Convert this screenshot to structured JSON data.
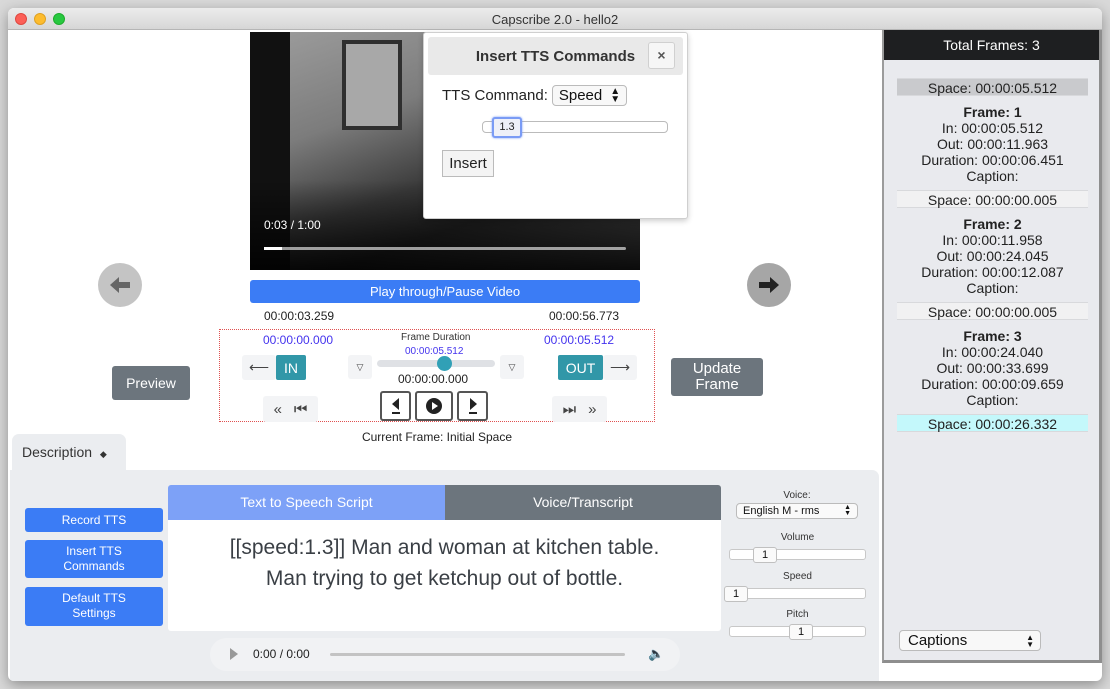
{
  "window": {
    "title": "Capscribe 2.0 - hello2"
  },
  "video": {
    "time_display": "0:03 / 1:00",
    "progress": 0.05
  },
  "modal": {
    "title": "Insert TTS Commands",
    "close_label": "×",
    "command_label": "TTS Command:",
    "command_value": "Speed",
    "slider_value": "1.3",
    "insert_label": "Insert"
  },
  "player": {
    "play_pause_label": "Play through/Pause Video",
    "start_time": "00:00:03.259",
    "end_time": "00:00:56.773"
  },
  "controls": {
    "in_time": "00:00:00.000",
    "out_time": "00:00:05.512",
    "frame_duration_label": "Frame Duration",
    "frame_duration_value": "00:00:05.512",
    "current_time": "00:00:00.000",
    "in_label": "IN",
    "out_label": "OUT",
    "current_frame_label": "Current Frame: Initial Space"
  },
  "buttons": {
    "preview": "Preview",
    "update_frame_line1": "Update",
    "update_frame_line2": "Frame"
  },
  "description": {
    "tab_label": "Description",
    "side_buttons": [
      {
        "line1": "Record TTS",
        "line2": ""
      },
      {
        "line1": "Insert TTS",
        "line2": "Commands"
      },
      {
        "line1": "Default TTS",
        "line2": "Settings"
      }
    ],
    "tabs": [
      {
        "label": "Text to Speech Script",
        "active": true
      },
      {
        "label": "Voice/Transcript",
        "active": false
      }
    ],
    "script_line1": "[[speed:1.3]] Man and woman at kitchen table.",
    "script_line2": "Man trying to get ketchup out of bottle.",
    "audio_time": "0:00 / 0:00"
  },
  "voice_settings": {
    "voice_label": "Voice:",
    "voice_value": "English M - rms",
    "volume_label": "Volume",
    "volume_value": "1",
    "speed_label": "Speed",
    "speed_value": "1",
    "pitch_label": "Pitch",
    "pitch_value": "1"
  },
  "frames_panel": {
    "header": "Total Frames: 3",
    "spaces": [
      "Space: 00:00:05.512",
      "Space: 00:00:00.005",
      "Space: 00:00:00.005",
      "Space: 00:00:26.332"
    ],
    "frames": [
      {
        "title": "Frame: 1",
        "in": "In: 00:00:05.512",
        "out": "Out: 00:00:11.963",
        "duration": "Duration: 00:00:06.451",
        "caption": "Caption:"
      },
      {
        "title": "Frame: 2",
        "in": "In: 00:00:11.958",
        "out": "Out: 00:00:24.045",
        "duration": "Duration: 00:00:12.087",
        "caption": "Caption:"
      },
      {
        "title": "Frame: 3",
        "in": "In: 00:00:24.040",
        "out": "Out: 00:00:33.699",
        "duration": "Duration: 00:00:09.659",
        "caption": "Caption:"
      }
    ],
    "mode_select": "Captions"
  }
}
